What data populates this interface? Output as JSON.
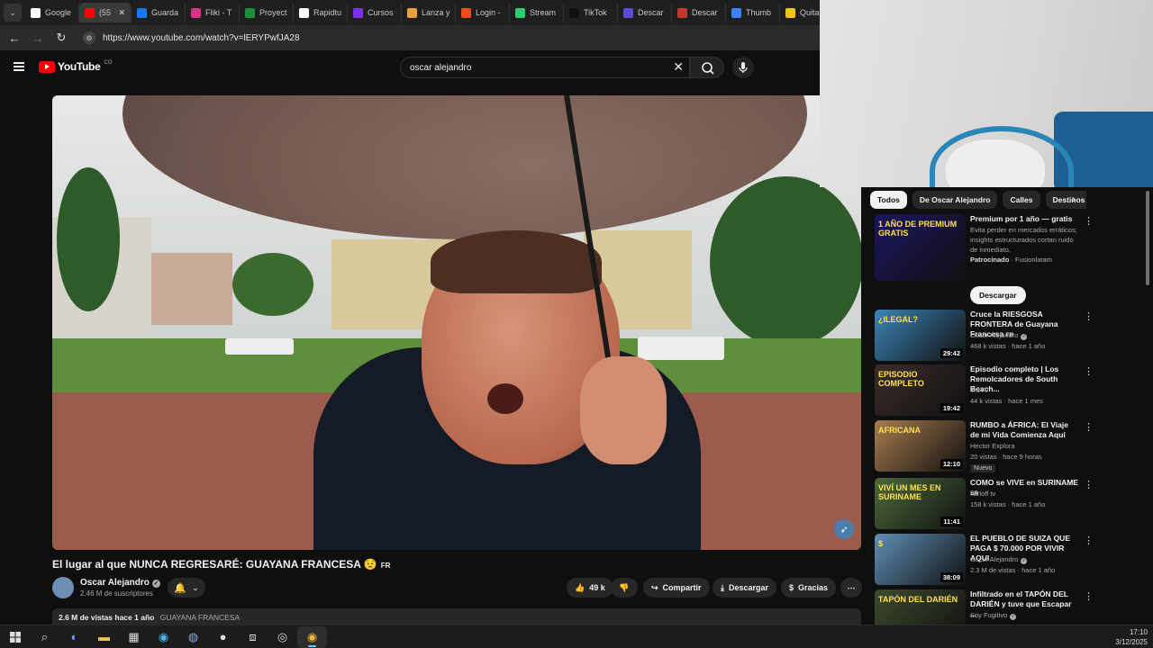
{
  "browser": {
    "tabs": [
      {
        "label": "Google",
        "color": "#ffffff"
      },
      {
        "label": "(55",
        "color": "#ff0000",
        "active": true
      },
      {
        "label": "Guarda",
        "color": "#1877f2"
      },
      {
        "label": "Fliki - T",
        "color": "#d63384"
      },
      {
        "label": "Proyect",
        "color": "#1e8e3e"
      },
      {
        "label": "Rapidtu",
        "color": "#ffffff"
      },
      {
        "label": "Cursos",
        "color": "#7b2ff7"
      },
      {
        "label": "Lanza y",
        "color": "#e9a23b"
      },
      {
        "label": "Login -",
        "color": "#e94e1b"
      },
      {
        "label": "Stream",
        "color": "#2ecc71"
      },
      {
        "label": "TikTok",
        "color": "#111111"
      },
      {
        "label": "Descar",
        "color": "#5b4bd6"
      },
      {
        "label": "Descar",
        "color": "#c0392b"
      },
      {
        "label": "Thumb",
        "color": "#3b82f6"
      },
      {
        "label": "Quitar",
        "color": "#f1c40f"
      }
    ],
    "close_glyph": "✕",
    "url": "https://www.youtube.com/watch?v=lERYPwfJA28"
  },
  "youtube": {
    "logo_text": "YouTube",
    "country_code": "CO",
    "search_value": "oscar alejandro",
    "video": {
      "title": "El lugar al que NUNCA REGRESARÉ: GUAYANA FRANCESA 😟",
      "title_lang": "FR",
      "channel": "Oscar Alejandro",
      "subscribers": "2.46 M de suscriptores",
      "likes": "49 k",
      "share": "Compartir",
      "download": "Descargar",
      "thanks": "Gracias",
      "views": "2.6 M de vistas",
      "age": "hace 1 año",
      "tag": "GUAYANA FRANCESA"
    },
    "chips": [
      "Todos",
      "De Oscar Alejandro",
      "Calles",
      "Destinos"
    ],
    "recommendations": [
      {
        "title": "Premium por 1 año — gratis",
        "meta1": "Evita perder en mercados erráticos; insights estructurados cortan ruido de inmediato.",
        "sponsored": "Patrocinado",
        "sponsor": "· Fusionlatam",
        "button": "Descargar",
        "thumb_text": "1 AÑO DE PREMIUM GRATIS",
        "thumb_color": "#1b1460"
      },
      {
        "title": "Cruce la RIESGOSA FRONTERA de Guayana Francesa",
        "lang": "FR",
        "channel": "Oscar Alejandro",
        "meta": "468 k vistas · hace 1 año",
        "duration": "29:42",
        "thumb_text": "¿ILEGAL?",
        "thumb_color": "#3b84b6"
      },
      {
        "title": "Episodio completo | Los Remolcadores de South Beach...",
        "channel": "TruTV",
        "meta": "44 k vistas · hace 1 mes",
        "duration": "19:42",
        "thumb_text": "EPISODIO COMPLETO",
        "thumb_color": "#3a2c2a"
      },
      {
        "title": "RUMBO a ÁFRICA: El Viaje de mi Vida Comienza Aquí",
        "channel": "Hector Explora",
        "meta": "20 vistas · hace 9 horas",
        "badge": "Nuevo",
        "duration": "12:10",
        "thumb_text": "Africana",
        "thumb_color": "#a87b4e"
      },
      {
        "title": "COMO se VIVE en SURINAME",
        "lang": "SR",
        "channel": "karloff tv",
        "meta": "158 k vistas · hace 1 año",
        "duration": "11:41",
        "thumb_text": "VIVÍ UN MES EN SURINAME",
        "thumb_color": "#4c6a3a"
      },
      {
        "title": "EL PUEBLO DE SUIZA QUE PAGA $ 70.000 POR VIVIR AQUI",
        "channel": "Oscar Alejandro",
        "meta": "2.3 M de vistas · hace 1 año",
        "duration": "38:09",
        "thumb_text": "$",
        "thumb_color": "#5f8fb8"
      },
      {
        "title": "Infiltrado en el TAPÓN DEL DARIÉN y tuve que Escapar ...",
        "channel": "Soy Fugitivo",
        "meta": "",
        "duration": "",
        "thumb_text": "TAPÓN DEL DARIÉN",
        "thumb_color": "#3e4a2e"
      }
    ]
  },
  "taskbar": {
    "time": "17:10",
    "date": "3/12/2025"
  }
}
